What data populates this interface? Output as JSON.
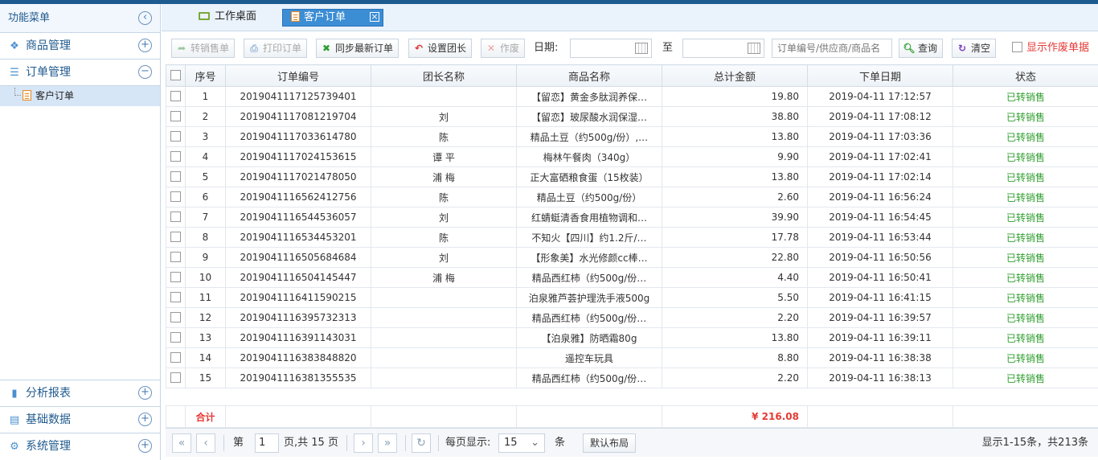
{
  "sidebar": {
    "title": "功能菜单",
    "collapse_icon": "chevron-left-icon",
    "sections": [
      {
        "label": "商品管理",
        "icon": "goods-icon",
        "toggle": "+"
      },
      {
        "label": "订单管理",
        "icon": "list-icon",
        "toggle": "−"
      }
    ],
    "sub_item": "客户订单",
    "bottom_sections": [
      {
        "label": "分析报表",
        "icon": "bar-chart-icon",
        "toggle": "+"
      },
      {
        "label": "基础数据",
        "icon": "data-icon",
        "toggle": "+"
      },
      {
        "label": "系统管理",
        "icon": "gear-icon",
        "toggle": "+"
      }
    ]
  },
  "tabs": [
    {
      "label": "工作桌面",
      "active": false
    },
    {
      "label": "客户订单",
      "active": true
    }
  ],
  "toolbar": {
    "to_sale": "转销售单",
    "print": "打印订单",
    "sync": "同步最新订单",
    "set_leader": "设置团长",
    "void": "作废",
    "date_label": "日期:",
    "to_label": "至",
    "date_from": "",
    "date_to": "",
    "search_placeholder": "订单编号/供应商/商品名",
    "query": "查询",
    "clear": "清空",
    "show_void": "显示作废单据"
  },
  "grid": {
    "columns": [
      "序号",
      "订单编号",
      "团长名称",
      "商品名称",
      "总计金额",
      "下单日期",
      "状态"
    ],
    "rows": [
      {
        "no": "1",
        "order": "2019041117125739401",
        "leader": "",
        "product": "【留恋】黄金多肽润养保…",
        "amount": "19.80",
        "date": "2019-04-11 17:12:57",
        "status": "已转销售"
      },
      {
        "no": "2",
        "order": "2019041117081219704",
        "leader": "刘",
        "product": "【留恋】玻尿酸水润保湿…",
        "amount": "38.80",
        "date": "2019-04-11 17:08:12",
        "status": "已转销售"
      },
      {
        "no": "3",
        "order": "2019041117033614780",
        "leader": "陈",
        "product": "精品土豆（约500g/份）,…",
        "amount": "13.80",
        "date": "2019-04-11 17:03:36",
        "status": "已转销售"
      },
      {
        "no": "4",
        "order": "2019041117024153615",
        "leader": "谭 平",
        "product": "梅林午餐肉（340g）",
        "amount": "9.90",
        "date": "2019-04-11 17:02:41",
        "status": "已转销售"
      },
      {
        "no": "5",
        "order": "2019041117021478050",
        "leader": "浦 梅",
        "product": "正大富硒粮食蛋（15枚装）",
        "amount": "13.80",
        "date": "2019-04-11 17:02:14",
        "status": "已转销售"
      },
      {
        "no": "6",
        "order": "2019041116562412756",
        "leader": "陈",
        "product": "精品土豆（约500g/份）",
        "amount": "2.60",
        "date": "2019-04-11 16:56:24",
        "status": "已转销售"
      },
      {
        "no": "7",
        "order": "2019041116544536057",
        "leader": "刘",
        "product": "红蜻蜓清香食用植物调和…",
        "amount": "39.90",
        "date": "2019-04-11 16:54:45",
        "status": "已转销售"
      },
      {
        "no": "8",
        "order": "2019041116534453201",
        "leader": "陈",
        "product": "不知火【四川】约1.2斤/…",
        "amount": "17.78",
        "date": "2019-04-11 16:53:44",
        "status": "已转销售"
      },
      {
        "no": "9",
        "order": "2019041116505684684",
        "leader": "刘",
        "product": "【形象美】水光修颜cc棒…",
        "amount": "22.80",
        "date": "2019-04-11 16:50:56",
        "status": "已转销售"
      },
      {
        "no": "10",
        "order": "2019041116504145447",
        "leader": "浦 梅",
        "product": "精品西红柿（约500g/份…",
        "amount": "4.40",
        "date": "2019-04-11 16:50:41",
        "status": "已转销售"
      },
      {
        "no": "11",
        "order": "2019041116411590215",
        "leader": "",
        "product": "泊泉雅芦荟护理洗手液500g",
        "amount": "5.50",
        "date": "2019-04-11 16:41:15",
        "status": "已转销售"
      },
      {
        "no": "12",
        "order": "2019041116395732313",
        "leader": "",
        "product": "精品西红柿（约500g/份…",
        "amount": "2.20",
        "date": "2019-04-11 16:39:57",
        "status": "已转销售"
      },
      {
        "no": "13",
        "order": "2019041116391143031",
        "leader": "",
        "product": "【泊泉雅】防晒霜80g",
        "amount": "13.80",
        "date": "2019-04-11 16:39:11",
        "status": "已转销售"
      },
      {
        "no": "14",
        "order": "2019041116383848820",
        "leader": "",
        "product": "遥控车玩具",
        "amount": "8.80",
        "date": "2019-04-11 16:38:38",
        "status": "已转销售"
      },
      {
        "no": "15",
        "order": "2019041116381355535",
        "leader": "",
        "product": "精品西红柿（约500g/份…",
        "amount": "2.20",
        "date": "2019-04-11 16:38:13",
        "status": "已转销售"
      }
    ],
    "total_label": "合计",
    "total_amount": "¥ 216.08"
  },
  "pager": {
    "page_prefix": "第",
    "page": "1",
    "page_suffix": "页,共 15 页",
    "per_page_label": "每页显示:",
    "per_page": "15",
    "per_page_unit": "条",
    "default_layout": "默认布局",
    "summary": "显示1-15条，共213条"
  },
  "colors": {
    "accent": "#3b8dd4",
    "status_green": "#2e9e2e",
    "total_red": "#e53935",
    "sidebar_selected": "#d7e6f7"
  }
}
